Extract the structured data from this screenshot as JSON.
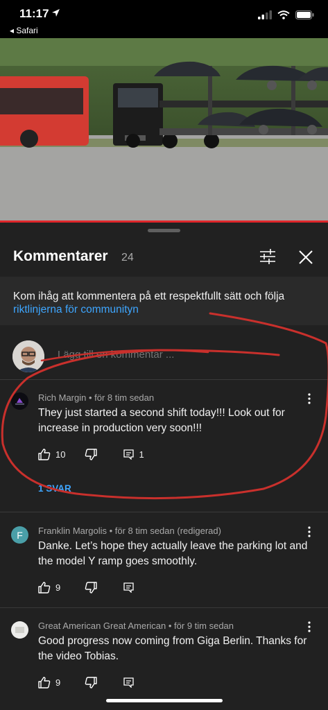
{
  "status_bar": {
    "time": "11:17",
    "back_label": "◂ Safari"
  },
  "header": {
    "title": "Kommentarer",
    "count": "24"
  },
  "guideline": {
    "text": "Kom ihåg att kommentera på ett respektfullt sätt och följa",
    "link": "riktlinjerna för communityn"
  },
  "add_comment": {
    "placeholder": "Lägg till en kommentar ..."
  },
  "comments": [
    {
      "author": "Rich Margin",
      "time": "för 8 tim sedan",
      "text": "They just started a second shift today!!! Look out for increase in production very soon!!!",
      "likes": "10",
      "replies_count": "1",
      "replies_link": "1 SVAR"
    },
    {
      "author": "Franklin Margolis",
      "time": "för 8 tim sedan (redigerad)",
      "avatar_letter": "F",
      "text": "Danke. Let’s hope they actually leave the parking lot and the model Y ramp goes smoothly.",
      "likes": "9"
    },
    {
      "author": "Great American Great American",
      "time": "för 9 tim sedan",
      "text": "Good progress now coming from Giga Berlin. Thanks for the video Tobias.",
      "likes": "9"
    }
  ],
  "colors": {
    "accent_link": "#3ea6ff",
    "annotation_red": "#c9302c",
    "background": "#212121"
  },
  "icons": [
    "location-arrow-icon",
    "signal-icon",
    "wifi-icon",
    "battery-icon",
    "filter-icon",
    "close-icon",
    "thumb-up-icon",
    "thumb-down-icon",
    "reply-icon",
    "more-vert-icon"
  ]
}
